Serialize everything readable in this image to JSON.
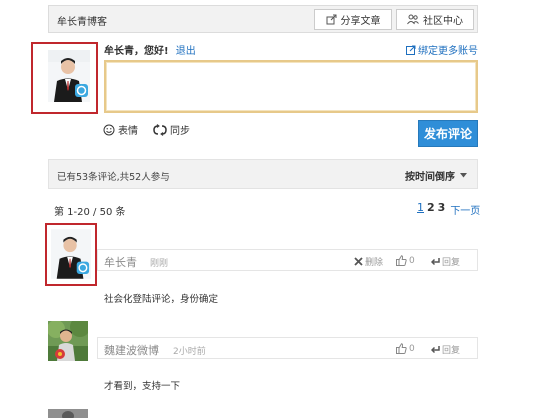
{
  "header": {
    "blog_name": "牟长青博客",
    "share_label": "分享文章",
    "community_label": "社区中心"
  },
  "composer": {
    "greeting": "牟长青，您好!",
    "logout_label": "退出",
    "bind_label": "绑定更多账号",
    "emoji_label": "表情",
    "sync_label": "同步",
    "publish_label": "发布评论",
    "textarea_value": ""
  },
  "summary": {
    "stats": "已有53条评论,共52人参与",
    "sort_label": "按时间倒序"
  },
  "pagination": {
    "range": "第 1-20 / 50 条",
    "pages": [
      "1",
      "2",
      "3"
    ],
    "next_label": "下一页"
  },
  "comments": [
    {
      "author": "牟长青",
      "time": "刚刚",
      "delete_label": "删除",
      "likes": "0",
      "reply_label": "回复",
      "text": "社会化登陆评论，身份确定"
    },
    {
      "author": "魏建波微博",
      "time": "2小时前",
      "likes": "0",
      "reply_label": "回复",
      "text": "才看到，支持一下"
    }
  ],
  "colors": {
    "accent": "#2f8ed8",
    "link": "#1e6fbf",
    "highlight_border": "#c0272d",
    "textarea_border": "#e7c98a"
  }
}
